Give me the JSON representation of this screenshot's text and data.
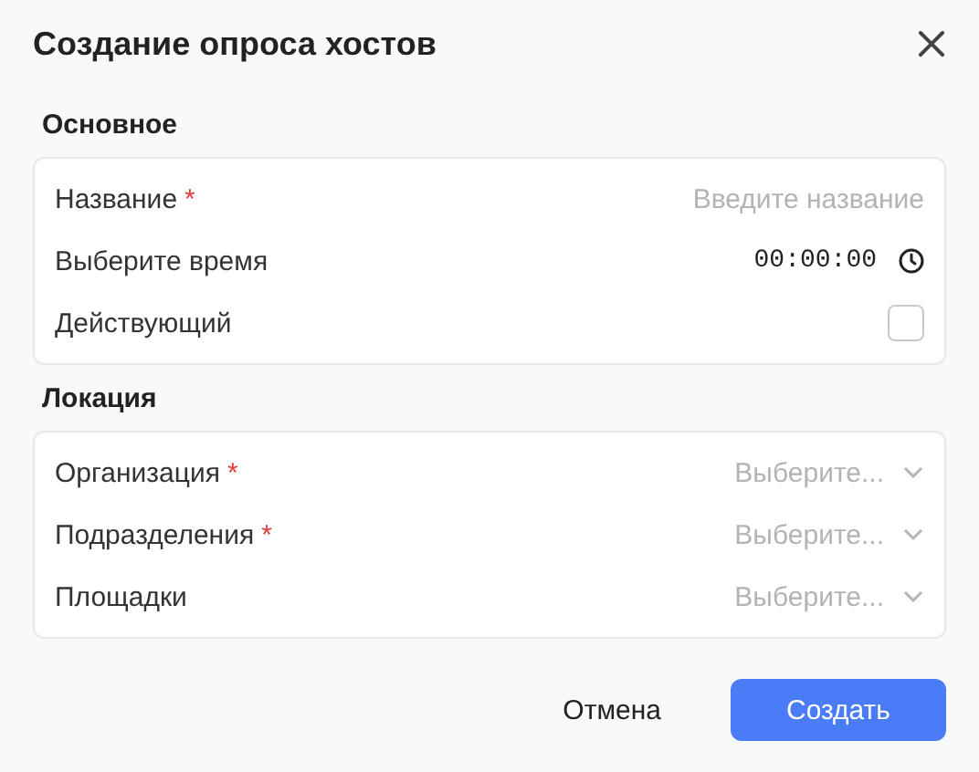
{
  "dialog": {
    "title": "Создание опроса хостов"
  },
  "sections": [
    {
      "title": "Основное",
      "fields": [
        {
          "kind": "text",
          "label": "Название",
          "required_mark": "*",
          "placeholder": "Введите название"
        },
        {
          "kind": "time",
          "label": "Выберите время",
          "value": "00:00:00"
        },
        {
          "kind": "checkbox",
          "label": "Действующий",
          "checked": false
        }
      ]
    },
    {
      "title": "Локация",
      "fields": [
        {
          "kind": "select",
          "label": "Организация",
          "required_mark": "*",
          "placeholder": "Выберите..."
        },
        {
          "kind": "select",
          "label": "Подразделения",
          "required_mark": "*",
          "placeholder": "Выберите..."
        },
        {
          "kind": "select",
          "label": "Площадки",
          "placeholder": "Выберите..."
        }
      ]
    }
  ],
  "buttons": [
    {
      "kind": "text",
      "label": "Отмена"
    },
    {
      "kind": "primary",
      "label": "Создать"
    }
  ]
}
